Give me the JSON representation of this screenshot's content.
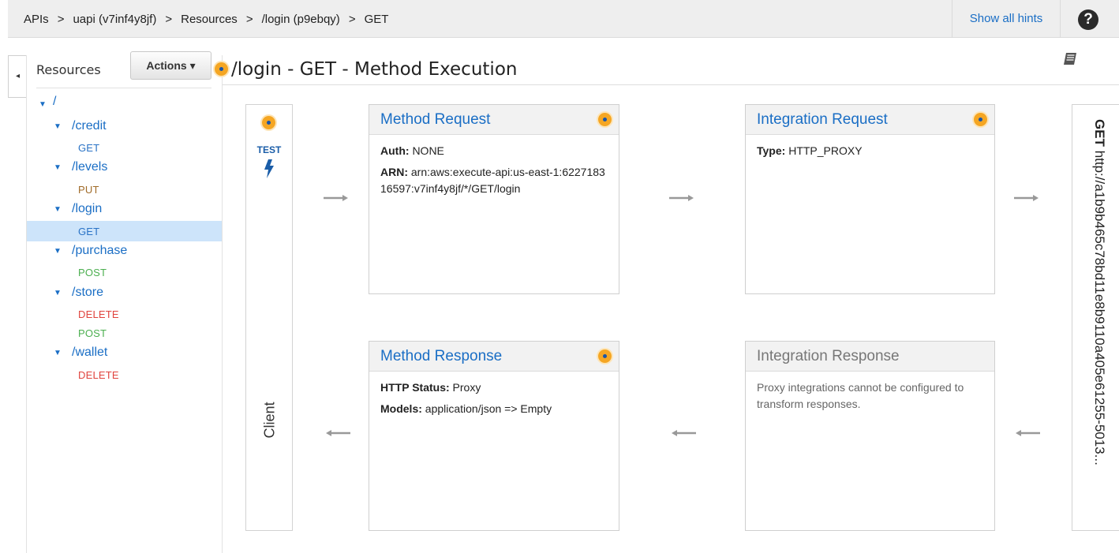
{
  "breadcrumb": {
    "items": [
      "APIs",
      "uapi (v7inf4y8jf)",
      "Resources",
      "/login (p9ebqy)",
      "GET"
    ],
    "separator": ">"
  },
  "header": {
    "show_hints": "Show all hints",
    "help": "?"
  },
  "sidebar": {
    "title": "Resources",
    "actions_label": "Actions",
    "actions_caret": "▾",
    "collapse_glyph": "◂",
    "tree": [
      {
        "type": "resource",
        "label": "/",
        "depth": 0
      },
      {
        "type": "resource",
        "label": "/credit",
        "depth": 1
      },
      {
        "type": "method",
        "label": "GET",
        "kind": "get"
      },
      {
        "type": "resource",
        "label": "/levels",
        "depth": 1
      },
      {
        "type": "method",
        "label": "PUT",
        "kind": "put"
      },
      {
        "type": "resource",
        "label": "/login",
        "depth": 1
      },
      {
        "type": "method",
        "label": "GET",
        "kind": "get",
        "selected": true
      },
      {
        "type": "resource",
        "label": "/purchase",
        "depth": 1
      },
      {
        "type": "method",
        "label": "POST",
        "kind": "post"
      },
      {
        "type": "resource",
        "label": "/store",
        "depth": 1
      },
      {
        "type": "method",
        "label": "DELETE",
        "kind": "delete"
      },
      {
        "type": "method",
        "label": "POST",
        "kind": "post"
      },
      {
        "type": "resource",
        "label": "/wallet",
        "depth": 1
      },
      {
        "type": "method",
        "label": "DELETE",
        "kind": "delete"
      }
    ]
  },
  "main": {
    "title": "/login - GET - Method Execution",
    "client": {
      "test_label": "TEST",
      "label": "Client"
    },
    "method_request": {
      "title": "Method Request",
      "auth_key": "Auth:",
      "auth_value": "NONE",
      "arn_key": "ARN:",
      "arn_value": "arn:aws:execute-api:us-east-1:622718316597:v7inf4y8jf/*/GET/login"
    },
    "integration_request": {
      "title": "Integration Request",
      "type_key": "Type:",
      "type_value": "HTTP_PROXY"
    },
    "method_response": {
      "title": "Method Response",
      "status_key": "HTTP Status:",
      "status_value": "Proxy",
      "models_key": "Models:",
      "models_value": "application/json => Empty"
    },
    "integration_response": {
      "title": "Integration Response",
      "note": "Proxy integrations cannot be configured to transform responses."
    },
    "endpoint": {
      "method": "GET",
      "url": "http://a1b9b465c78bd11e8b9110a405e61255-5013..."
    }
  },
  "colors": {
    "link": "#1a6ec5",
    "badge": "#f5a623",
    "get": "#2a73c6",
    "put": "#a06b28",
    "post": "#4caf50",
    "delete": "#e0443e",
    "selected_row": "#cde4fa"
  }
}
